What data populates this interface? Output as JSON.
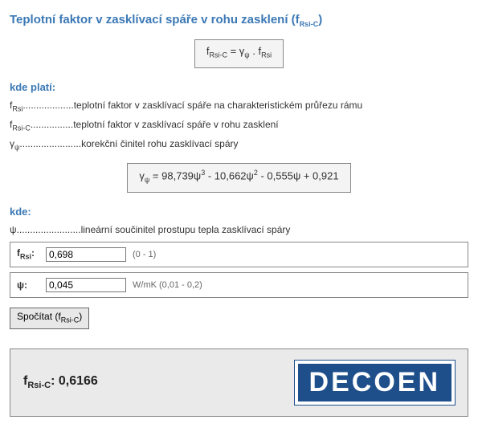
{
  "title": {
    "prefix": "Teplotní faktor v zasklívací spáře v rohu zasklení (f",
    "sub": "Rsi-C",
    "suffix": ")"
  },
  "formula1": {
    "lhs_base": "f",
    "lhs_sub": "Rsi-C",
    "eq": " = ",
    "mid_base": "γ",
    "mid_sub": "ψ",
    "dot": " . ",
    "rhs_base": "f",
    "rhs_sub": "Rsi"
  },
  "kde_plati": "kde platí:",
  "defs": {
    "frsi": {
      "sym_base": "f",
      "sym_sub": "Rsi",
      "dots": "...................",
      "text": "teplotní faktor v zasklívací spáře na charakteristickém průřezu rámu"
    },
    "frsic": {
      "sym_base": "f",
      "sym_sub": "Rsi-C",
      "dots": "................",
      "text": "teplotní faktor v zasklívací spáře v rohu zasklení"
    },
    "gpsi": {
      "sym_base": "γ",
      "sym_sub": "ψ",
      "dots": ".......................",
      "text": "korekční činitel rohu zasklívací spáry"
    }
  },
  "formula2": {
    "g_base": "γ",
    "g_sub": "ψ",
    "eq": " = ",
    "c3": "98,739",
    "p3": "ψ",
    "e3": "3",
    "m1": " - ",
    "c2": "10,662",
    "p2": "ψ",
    "e2": "2",
    "m2": " - ",
    "c1": "0,555",
    "p1": "ψ",
    "pl": " + ",
    "c0": "0,921"
  },
  "kde": "kde:",
  "def_psi": {
    "sym": "ψ",
    "dots": "........................",
    "text": "lineární součinitel prostupu tepla zasklívací spáry"
  },
  "inputs": {
    "frsi": {
      "lbl_base": "f",
      "lbl_sub": "Rsi",
      "colon": ":",
      "value": "0,698",
      "hint": "(0 - 1)"
    },
    "psi": {
      "lbl": "ψ:",
      "value": "0,045",
      "hint": "W/mK (0,01 - 0,2)"
    }
  },
  "button": {
    "prefix": "Spočítat (f",
    "sub": "Rsi-C",
    "suffix": ")"
  },
  "result": {
    "sym_base": "f",
    "sym_sub": "Rsi-C",
    "colon": ": ",
    "value": "0,6166"
  },
  "logo": "DECOEN"
}
